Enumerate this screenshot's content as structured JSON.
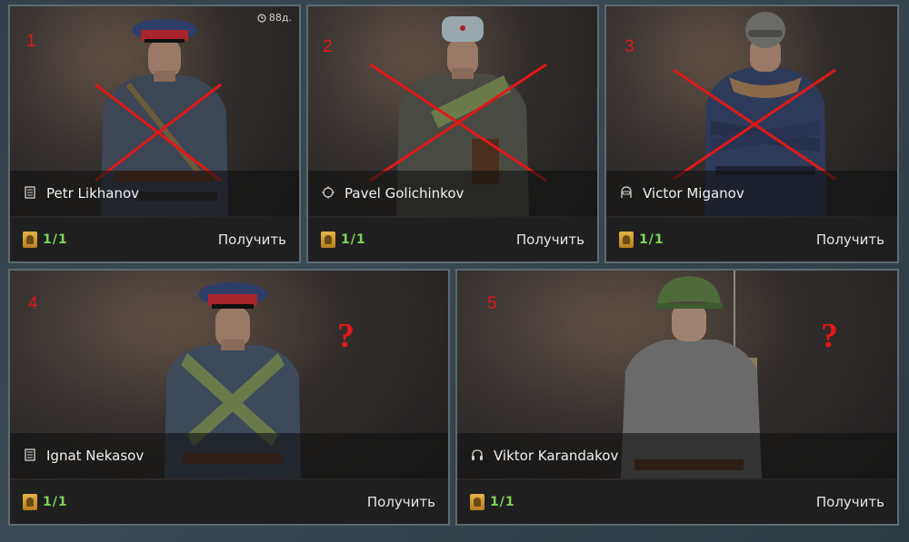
{
  "cards": [
    {
      "number": "1",
      "name": "Petr Likhanov",
      "class_icon": "manual-icon",
      "count": "1/1",
      "action": "Получить",
      "timer": "88д.",
      "crossed": true,
      "question": ""
    },
    {
      "number": "2",
      "name": "Pavel Golichinkov",
      "class_icon": "crosshair-icon",
      "count": "1/1",
      "action": "Получить",
      "crossed": true,
      "question": ""
    },
    {
      "number": "3",
      "name": "Victor Miganov",
      "class_icon": "pilot-helmet-icon",
      "count": "1/1",
      "action": "Получить",
      "crossed": true,
      "question": ""
    },
    {
      "number": "4",
      "name": "Ignat Nekasov",
      "class_icon": "manual-icon",
      "count": "1/1",
      "action": "Получить",
      "crossed": false,
      "question": "?"
    },
    {
      "number": "5",
      "name": "Viktor Karandakov",
      "class_icon": "headset-icon",
      "count": "1/1",
      "action": "Получить",
      "crossed": false,
      "question": "?"
    }
  ],
  "colors": {
    "annotation_red": "#e01818",
    "count_green": "#7ed35a",
    "badge_gold": "#e3b34a"
  }
}
